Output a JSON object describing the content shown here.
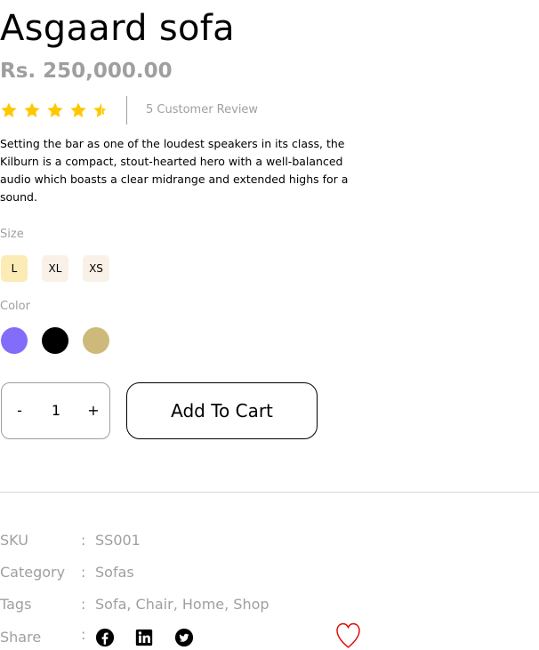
{
  "product": {
    "name": "Asgaard sofa",
    "price": "Rs. 250,000.00",
    "rating": 4.5,
    "rating_max": 5,
    "review_text": "5 Customer Review",
    "description": "Setting the bar as one of the loudest speakers in its class, the Kilburn is a compact, stout-hearted hero with a well-balanced audio which boasts a clear midrange and extended highs for a sound."
  },
  "size": {
    "label": "Size",
    "options": [
      "L",
      "XL",
      "XS"
    ],
    "selected": "L"
  },
  "color": {
    "label": "Color",
    "swatches": [
      "#816dfa",
      "#000000",
      "#cdba7b"
    ]
  },
  "quantity": {
    "minus": "-",
    "value": "1",
    "plus": "+"
  },
  "actions": {
    "add_to_cart": "Add To Cart"
  },
  "meta": {
    "colon": ":",
    "sku": {
      "label": "SKU",
      "value": "SS001"
    },
    "category": {
      "label": "Category",
      "value": "Sofas"
    },
    "tags": {
      "label": "Tags",
      "value": "Sofa, Chair, Home, Shop"
    },
    "share": {
      "label": "Share",
      "icons": [
        "facebook-icon",
        "linkedin-icon",
        "twitter-icon"
      ]
    }
  },
  "colors": {
    "star": "#ffc700",
    "muted_text": "#9f9f9f",
    "size_bg": "#f9f1e7",
    "size_selected_bg": "#fbebb5",
    "wishlist": "#e00000"
  }
}
